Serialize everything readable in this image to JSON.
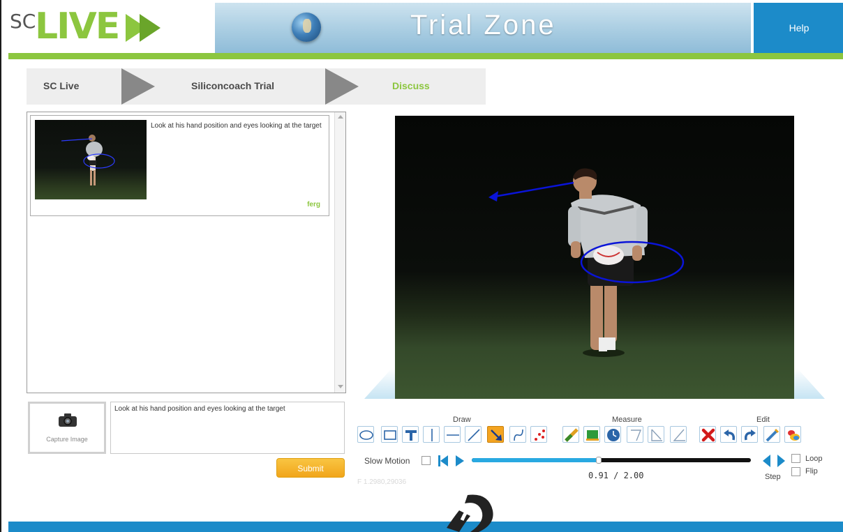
{
  "header": {
    "logo_prefix": "SC",
    "logo_main": "LIVE",
    "title": "Trial Zone",
    "help_label": "Help"
  },
  "breadcrumb": {
    "items": [
      "SC Live",
      "Siliconcoach Trial",
      "Discuss"
    ]
  },
  "comments": [
    {
      "text": "Look at his hand position and eyes looking at the target",
      "author": "ferg"
    }
  ],
  "capture": {
    "label": "Capture Image"
  },
  "comment_input": {
    "value": "Look at his hand position and eyes looking at the target"
  },
  "submit_label": "Submit",
  "coord_readout": "F 1.2980,29036",
  "tools": {
    "draw_label": "Draw",
    "measure_label": "Measure",
    "edit_label": "Edit",
    "draw": [
      "ellipse-tool-icon",
      "rectangle-tool-icon",
      "text-tool-icon",
      "vertical-line-tool-icon",
      "horizontal-line-tool-icon",
      "line-tool-icon",
      "arrow-tool-icon",
      "curve-tool-icon",
      "points-tool-icon"
    ],
    "measure": [
      "ruler-measure-icon",
      "area-measure-icon",
      "timer-measure-icon",
      "angle-up-measure-icon",
      "angle-right-measure-icon",
      "angle-measure-icon"
    ],
    "edit": [
      "delete-icon",
      "undo-icon",
      "redo-icon",
      "pen-settings-icon",
      "color-settings-icon"
    ],
    "active_tool": "arrow-tool-icon"
  },
  "playback": {
    "slow_motion_label": "Slow Motion",
    "time_current": "0.91",
    "time_total": "2.00",
    "time_display": "0.91 / 2.00",
    "progress_fraction": 0.455,
    "step_label": "Step",
    "loop_label": "Loop",
    "flip_label": "Flip"
  },
  "colors": {
    "brand_green": "#8cc63f",
    "brand_blue": "#1c8bc9",
    "annotation_blue": "#0a14d8",
    "submit_orange": "#f1a51b",
    "progress_blue": "#29a9e1"
  }
}
